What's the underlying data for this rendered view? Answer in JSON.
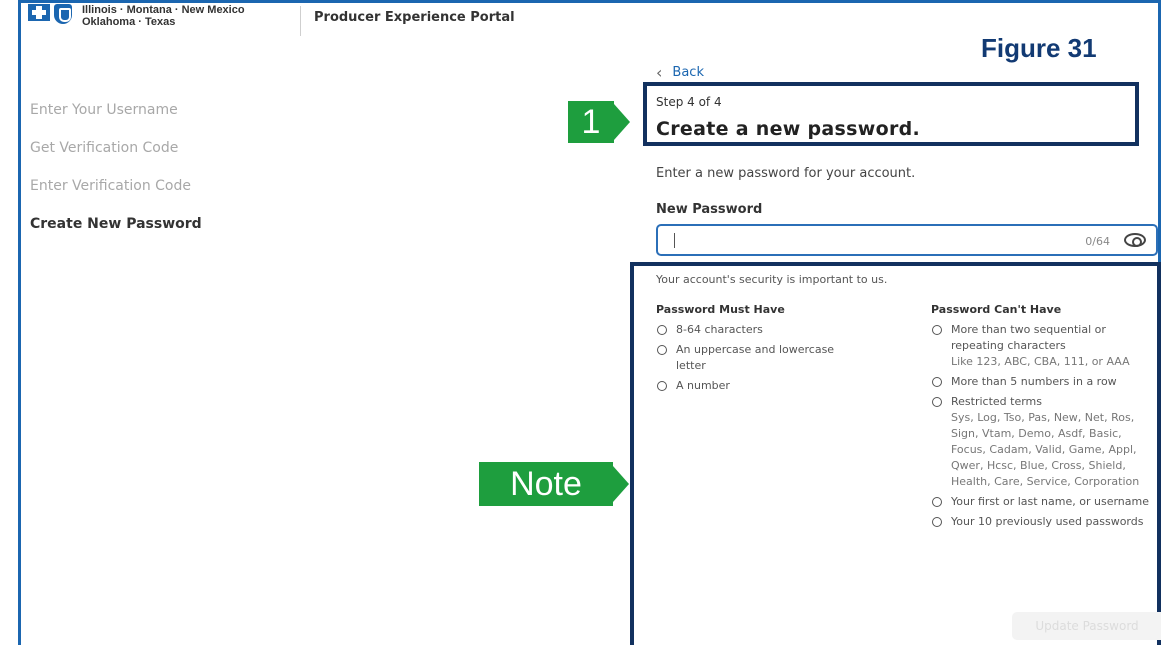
{
  "header": {
    "logo_line1": "Illinois · Montana · New Mexico",
    "logo_line2": "Oklahoma · Texas",
    "portal_name": "Producer Experience Portal"
  },
  "figure_label": "Figure 31",
  "steps": [
    {
      "label": "Enter Your Username",
      "active": false
    },
    {
      "label": "Get Verification Code",
      "active": false
    },
    {
      "label": "Enter Verification Code",
      "active": false
    },
    {
      "label": "Create New Password",
      "active": true
    }
  ],
  "form": {
    "back_label": "Back",
    "step_count": "Step 4 of 4",
    "title": "Create a new password.",
    "instruction": "Enter a new password for your account.",
    "field_label": "New Password",
    "field_value": "",
    "counter": "0/64",
    "security_note": "Your account's security is important to us.",
    "must_have_title": "Password Must Have",
    "must_have": [
      "8-64 characters",
      "An uppercase and lowercase letter",
      "A number"
    ],
    "cant_have_title": "Password Can't Have",
    "cant_have": [
      {
        "text": "More than two sequential or repeating characters",
        "sub": "Like 123, ABC, CBA, 111, or AAA"
      },
      {
        "text": "More than 5 numbers in a row",
        "sub": ""
      },
      {
        "text": "Restricted terms",
        "sub": "Sys, Log, Tso, Pas, New, Net, Ros, Sign, Vtam, Demo, Asdf, Basic, Focus, Cadam, Valid, Game, Appl, Qwer, Hcsc, Blue, Cross, Shield, Health, Care, Service, Corporation"
      },
      {
        "text": "Your first or last name, or username",
        "sub": ""
      },
      {
        "text": "Your 10 previously used passwords",
        "sub": ""
      }
    ],
    "update_button": "Update Password"
  },
  "callouts": {
    "step": "1",
    "note": "Note"
  },
  "colors": {
    "accent": "#1b66b0",
    "highlight_border": "#12315f",
    "callout": "#1e9e3e"
  }
}
